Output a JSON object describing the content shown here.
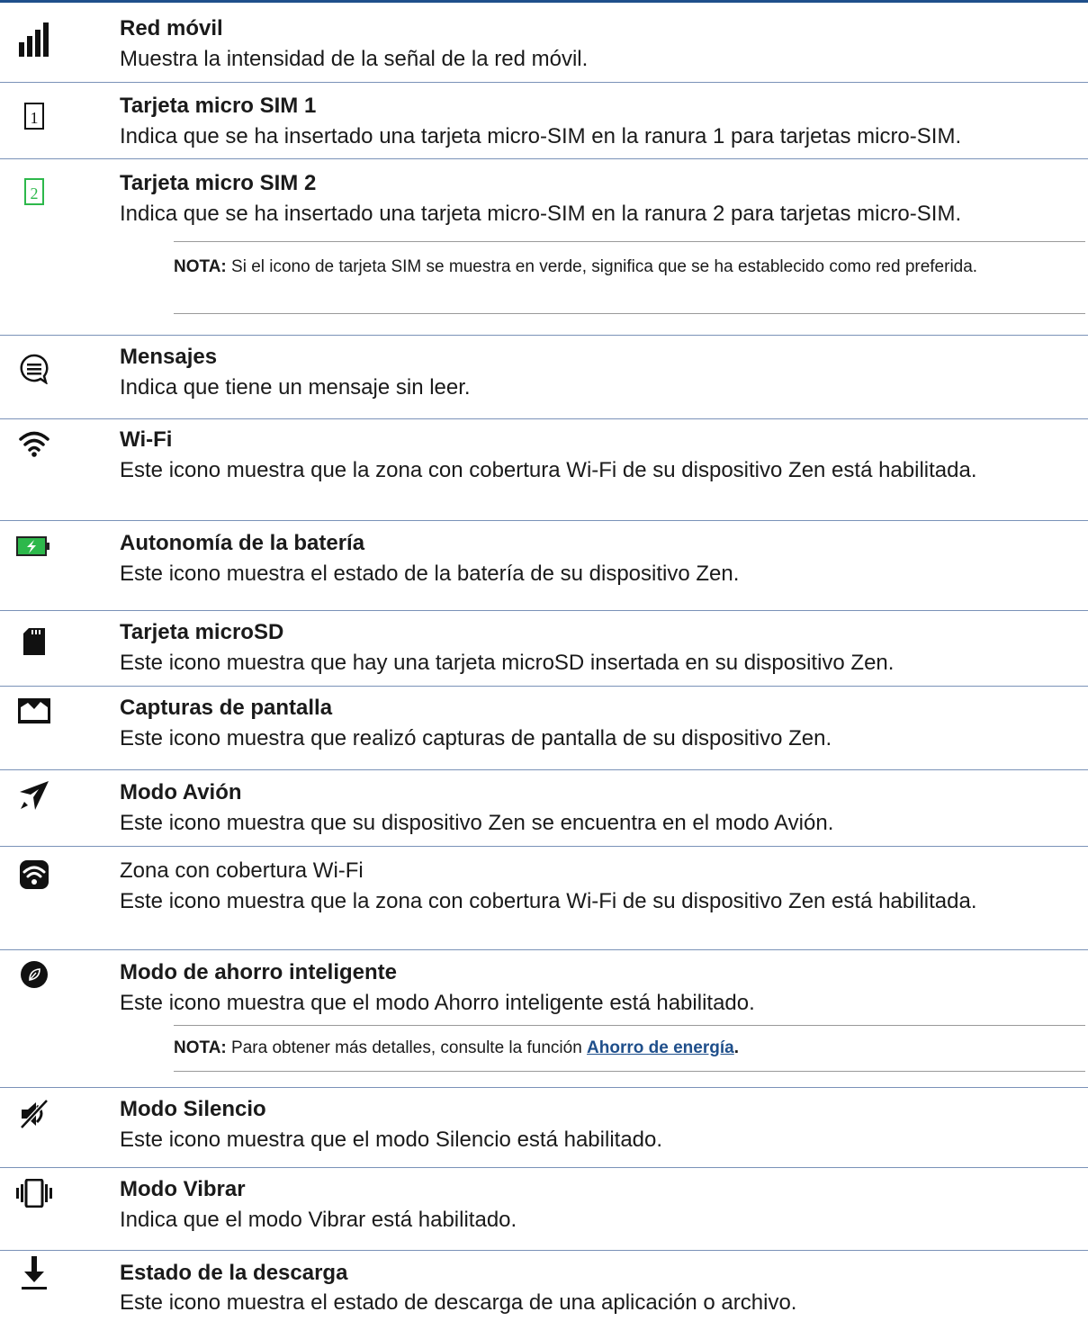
{
  "items": [
    {
      "icon": "signal-bars-icon",
      "title": "Red móvil",
      "desc": "Muestra la intensidad de la señal de la red móvil."
    },
    {
      "icon": "sim-card-1-icon",
      "title": "Tarjeta micro SIM 1",
      "desc": "Indica que se ha insertado una tarjeta micro-SIM en la ranura 1 para tarjetas micro-SIM."
    },
    {
      "icon": "sim-card-2-icon",
      "title": "Tarjeta micro SIM 2",
      "desc": "Indica que se ha insertado una tarjeta micro-SIM en la ranura 2 para tarjetas micro-SIM."
    },
    {
      "icon": "message-bubble-icon",
      "title": "Mensajes",
      "desc": "Indica que tiene un mensaje sin leer."
    },
    {
      "icon": "wifi-icon",
      "title": "Wi-Fi",
      "desc": "Este icono muestra que la zona con cobertura Wi-Fi de su dispositivo Zen está habilitada."
    },
    {
      "icon": "battery-charging-icon",
      "title": "Autonomía de la batería",
      "desc": "Este icono muestra el estado de la batería de su dispositivo Zen."
    },
    {
      "icon": "microsd-card-icon",
      "title": "Tarjeta microSD",
      "desc": "Este icono muestra que hay una tarjeta microSD insertada en su dispositivo Zen."
    },
    {
      "icon": "screenshot-image-icon",
      "title": "Capturas de pantalla",
      "desc": "Este icono muestra que realizó capturas de pantalla de su dispositivo Zen."
    },
    {
      "icon": "airplane-icon",
      "title": "Modo Avión",
      "desc": "Este icono muestra que su dispositivo Zen se encuentra en el modo Avión."
    },
    {
      "icon": "wifi-hotspot-icon",
      "title": "Zona con cobertura Wi-Fi",
      "desc": "Este icono muestra que la zona con cobertura Wi-Fi de su dispositivo Zen está habilitada."
    },
    {
      "icon": "power-saver-leaf-icon",
      "title": "Modo de ahorro inteligente",
      "desc": "Este icono muestra que el modo Ahorro inteligente está habilitado."
    },
    {
      "icon": "silent-mode-icon",
      "title": "Modo Silencio",
      "desc": "Este icono muestra que el modo Silencio está habilitado."
    },
    {
      "icon": "vibrate-mode-icon",
      "title": "Modo Vibrar",
      "desc": "Indica que el modo Vibrar está habilitado."
    },
    {
      "icon": "download-arrow-icon",
      "title": "Estado de la descarga",
      "desc": "Este icono muestra el estado de descarga de una aplicación o archivo."
    }
  ],
  "notes": {
    "sim": {
      "label": "NOTA:",
      "text": " Si el icono de tarjeta SIM se muestra en verde, significa que se ha establecido como red preferida."
    },
    "saver": {
      "label": "NOTA:",
      "text": " Para obtener más detalles, consulte la función ",
      "link": "Ahorro de energía",
      "end": "."
    }
  },
  "colors": {
    "accent": "#1f4f8b",
    "sim_green": "#2db84b",
    "battery_green": "#2db84b"
  }
}
